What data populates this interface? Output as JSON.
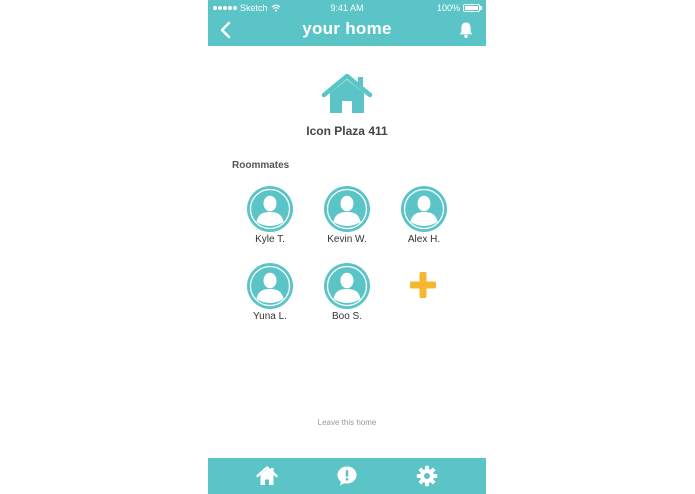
{
  "status_bar": {
    "carrier": "Sketch",
    "time": "9:41 AM",
    "battery": "100%",
    "battery_level": 1.0
  },
  "header": {
    "title": "your home",
    "back_icon": "chevron-left-icon",
    "notification_icon": "bell-icon"
  },
  "home": {
    "icon": "house-icon",
    "address": "Icon Plaza 411"
  },
  "roommates": {
    "label": "Roommates",
    "items": [
      {
        "name": "Kyle T."
      },
      {
        "name": "Kevin W."
      },
      {
        "name": "Alex H."
      },
      {
        "name": "Yuna L."
      },
      {
        "name": "Boo S."
      }
    ],
    "add_icon": "plus-icon"
  },
  "leave_label": "Leave this home",
  "tab_bar": {
    "items": [
      {
        "icon": "house-icon"
      },
      {
        "icon": "chat-alert-icon"
      },
      {
        "icon": "gear-icon"
      }
    ]
  },
  "colors": {
    "brand": "#5bc4c6",
    "accent": "#f5b731",
    "text": "#444444"
  }
}
